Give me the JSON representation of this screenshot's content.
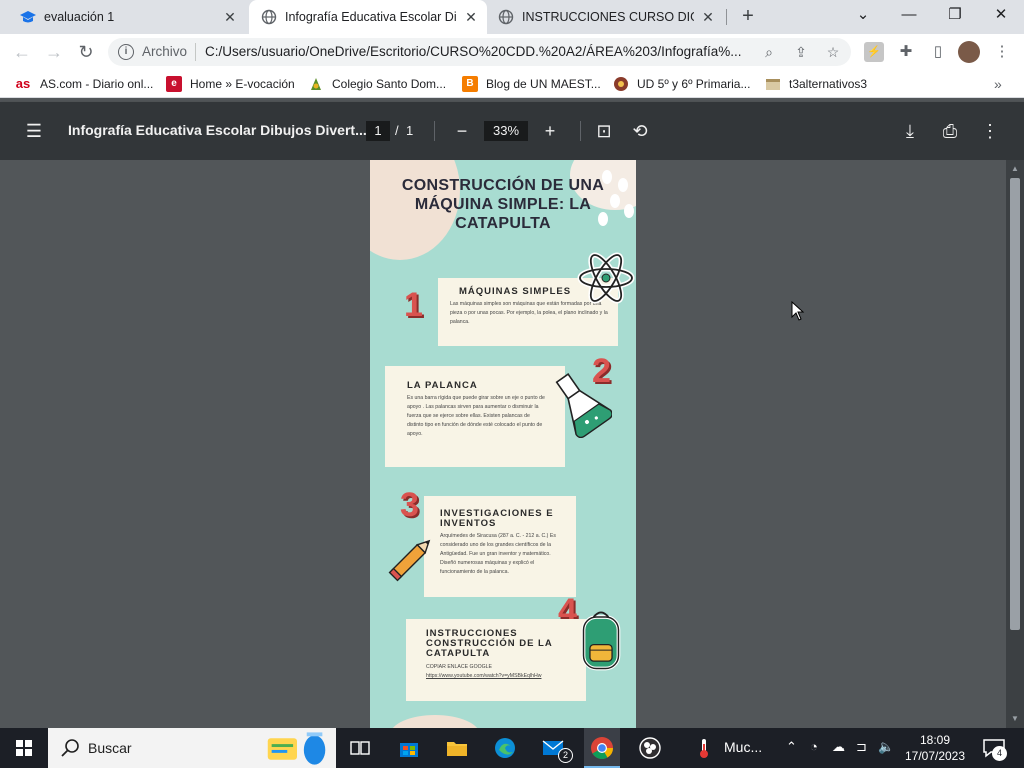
{
  "tabs": [
    {
      "title": "evaluación 1",
      "icon": "graduation-cap-icon"
    },
    {
      "title": "Infografía Educativa Escolar Dibu",
      "icon": "globe-icon"
    },
    {
      "title": "INSTRUCCIONES CURSO DIGITAL",
      "icon": "globe-icon"
    }
  ],
  "address": {
    "scheme_label": "Archivo",
    "url": "C:/Users/usuario/OneDrive/Escritorio/CURSO%20CDD.%20A2/ÁREA%203/Infografía%..."
  },
  "bookmarks": [
    {
      "label": "AS.com - Diario onl...",
      "icon": "as-logo-icon",
      "icon_text": "as"
    },
    {
      "label": "Home » E-vocación",
      "icon": "e-logo-icon",
      "icon_text": "e"
    },
    {
      "label": "Colegio Santo Dom...",
      "icon": "colegio-logo-icon"
    },
    {
      "label": "Blog de UN MAEST...",
      "icon": "blogger-icon",
      "icon_text": "B"
    },
    {
      "label": "UD 5º y 6º Primaria...",
      "icon": "ud-logo-icon"
    },
    {
      "label": "t3alternativos3",
      "icon": "t3-logo-icon"
    }
  ],
  "pdf_toolbar": {
    "title": "Infografía Educativa Escolar Dibujos Divert...",
    "page_current": "1",
    "page_sep": "/",
    "page_total": "1",
    "zoom": "33%"
  },
  "document": {
    "title": "CONSTRUCCIÓN DE UNA MÁQUINA SIMPLE: LA CATAPULTA",
    "sections": [
      {
        "number": "1",
        "heading": "MÁQUINAS SIMPLES",
        "body": "Las máquinas simples son máquinas que están formadas por una pieza o por unas pocas. Por ejemplo, la polea, el plano inclinado y la palanca."
      },
      {
        "number": "2",
        "heading": "LA PALANCA",
        "body": "Es una barra rígida que puede girar sobre un eje o punto de apoyo . Las palancas sirven para aumentar o disminuir la fuerza que se ejerce sobre ellas. Existen palancas de distinto tipo en función de dónde esté colocado el punto de apoyo."
      },
      {
        "number": "3",
        "heading": "INVESTIGACIONES E INVENTOS",
        "body": "Arquímedes de Siracusa (287 a. C. - 212 a. C.) Es considerado uno de los grandes científicos de la Antigüedad. Fue un gran inventor y matemático. Diseñó numerosas máquinas y explicó el funcionamiento de la palanca."
      },
      {
        "number": "4",
        "heading": "INSTRUCCIONES CONSTRUCCIÓN DE LA CATAPULTA",
        "body": "COPIAR ENLACE GOOGLE",
        "link": "https://www.youtube.com/watch?v=yMSBkEqlhHw"
      }
    ]
  },
  "taskbar": {
    "search_label": "Buscar",
    "mail_badge": "2",
    "weather_label": "Muc...",
    "time": "18:09",
    "date": "17/07/2023",
    "notif_count": "4"
  }
}
